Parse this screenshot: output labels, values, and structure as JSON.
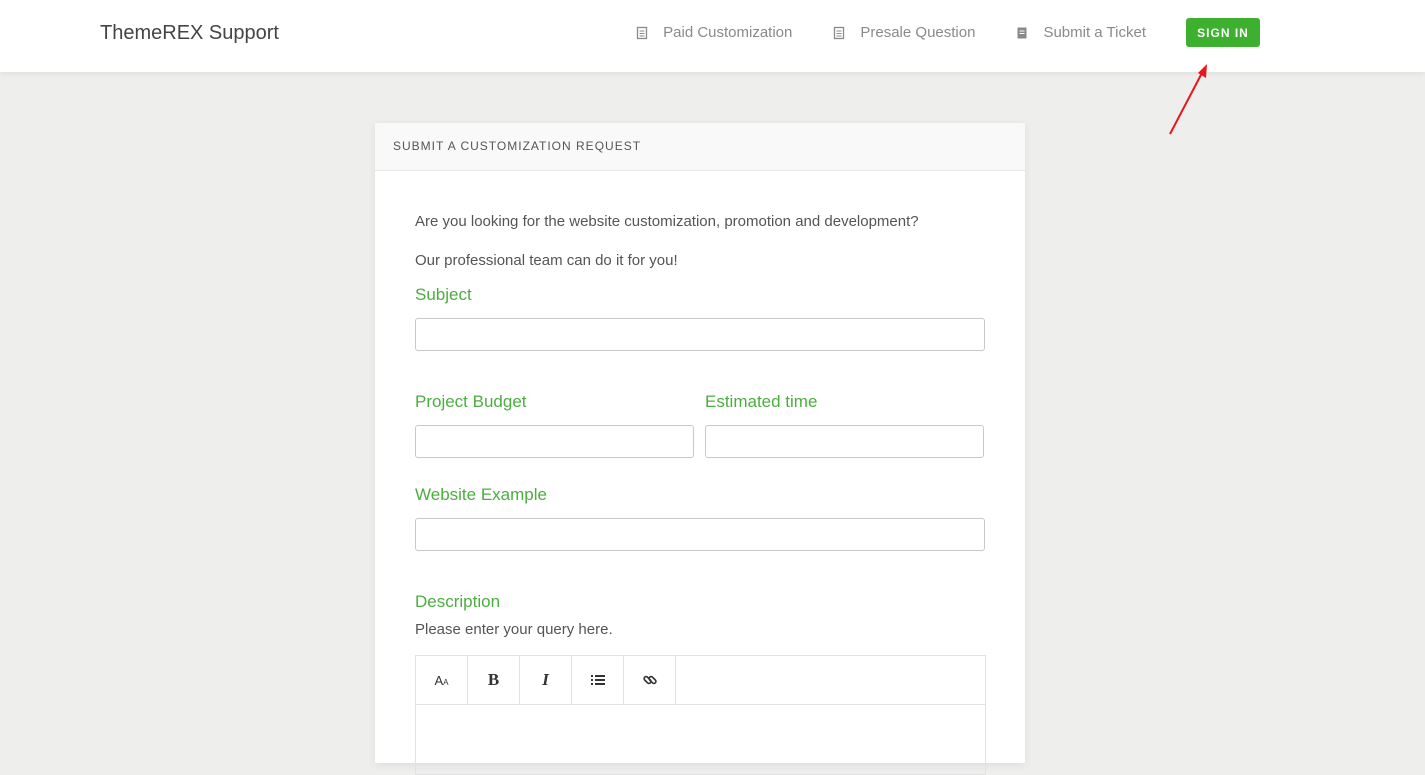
{
  "header": {
    "brand": "ThemeREX Support",
    "nav": [
      {
        "label": "Paid Customization",
        "icon": "document-icon"
      },
      {
        "label": "Presale Question",
        "icon": "document-icon"
      },
      {
        "label": "Submit a Ticket",
        "icon": "document-filled-icon"
      }
    ],
    "signin_label": "SIGN IN"
  },
  "colors": {
    "accent": "#3db12f",
    "label": "#4cae3f",
    "arrow": "#e8171b"
  },
  "form": {
    "title": "SUBMIT A CUSTOMIZATION REQUEST",
    "intro_1": "Are you looking for the website customization, promotion and development?",
    "intro_2": "Our professional team can do it for you!",
    "subject_label": "Subject",
    "budget_label": "Project Budget",
    "time_label": "Estimated time",
    "example_label": "Website Example",
    "description_label": "Description",
    "description_helper": "Please enter your query here.",
    "editor_tools": [
      {
        "name": "font-size-icon",
        "glyph": "Aa"
      },
      {
        "name": "bold-icon",
        "glyph": "B"
      },
      {
        "name": "italic-icon",
        "glyph": "I"
      },
      {
        "name": "list-icon",
        "glyph": "list"
      },
      {
        "name": "link-icon",
        "glyph": "link"
      }
    ]
  }
}
